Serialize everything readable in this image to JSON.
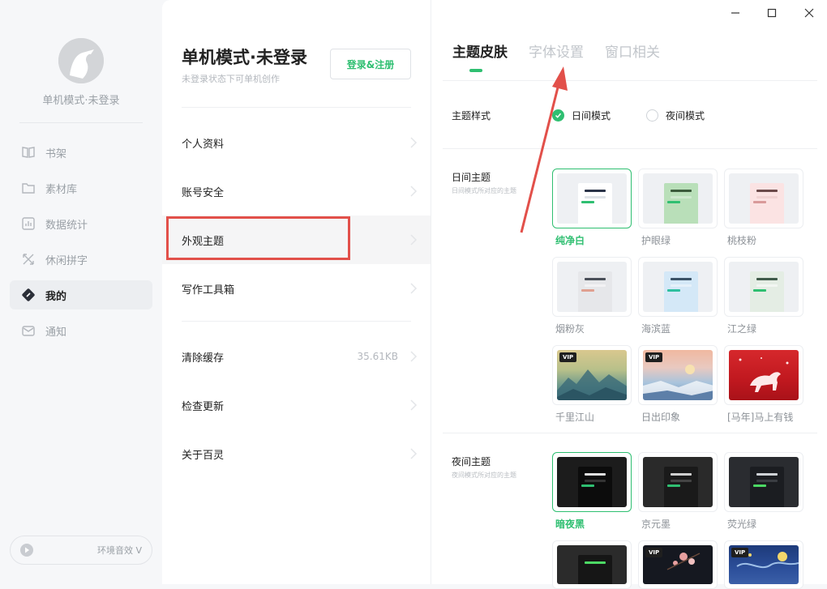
{
  "sidebar": {
    "user_name": "单机模式·未登录",
    "items": [
      {
        "label": "书架",
        "icon": "book-icon"
      },
      {
        "label": "素材库",
        "icon": "folder-icon"
      },
      {
        "label": "数据统计",
        "icon": "chart-icon"
      },
      {
        "label": "休闲拼字",
        "icon": "puzzle-icon"
      },
      {
        "label": "我的",
        "icon": "profile-icon"
      },
      {
        "label": "通知",
        "icon": "mail-icon"
      }
    ],
    "sound_label": "环境音效 V"
  },
  "middle": {
    "title": "单机模式·未登录",
    "subtitle": "未登录状态下可单机创作",
    "login_button": "登录&注册",
    "menu": [
      {
        "label": "个人资料"
      },
      {
        "label": "账号安全"
      },
      {
        "label": "外观主题"
      },
      {
        "label": "写作工具箱"
      },
      {
        "label": "清除缓存",
        "value": "35.61KB"
      },
      {
        "label": "检查更新"
      },
      {
        "label": "关于百灵"
      }
    ]
  },
  "right": {
    "tabs": [
      "主题皮肤",
      "字体设置",
      "窗口相关"
    ],
    "theme_style_label": "主题样式",
    "mode_day": "日间模式",
    "mode_night": "夜间模式",
    "day_section": {
      "title": "日间主题",
      "subtitle": "日间模式所对应的主题",
      "themes": [
        "纯净白",
        "护眼绿",
        "桃枝粉",
        "烟粉灰",
        "海滨蓝",
        "江之绿",
        "千里江山",
        "日出印象",
        "[马年]马上有钱"
      ]
    },
    "night_section": {
      "title": "夜间主题",
      "subtitle": "夜间模式所对应的主题",
      "themes": [
        "暗夜黑",
        "京元墨",
        "荧光绿"
      ]
    },
    "vip_badge": "VIP"
  },
  "colors": {
    "accent": "#2fbf71",
    "highlight": "#e2504a"
  }
}
